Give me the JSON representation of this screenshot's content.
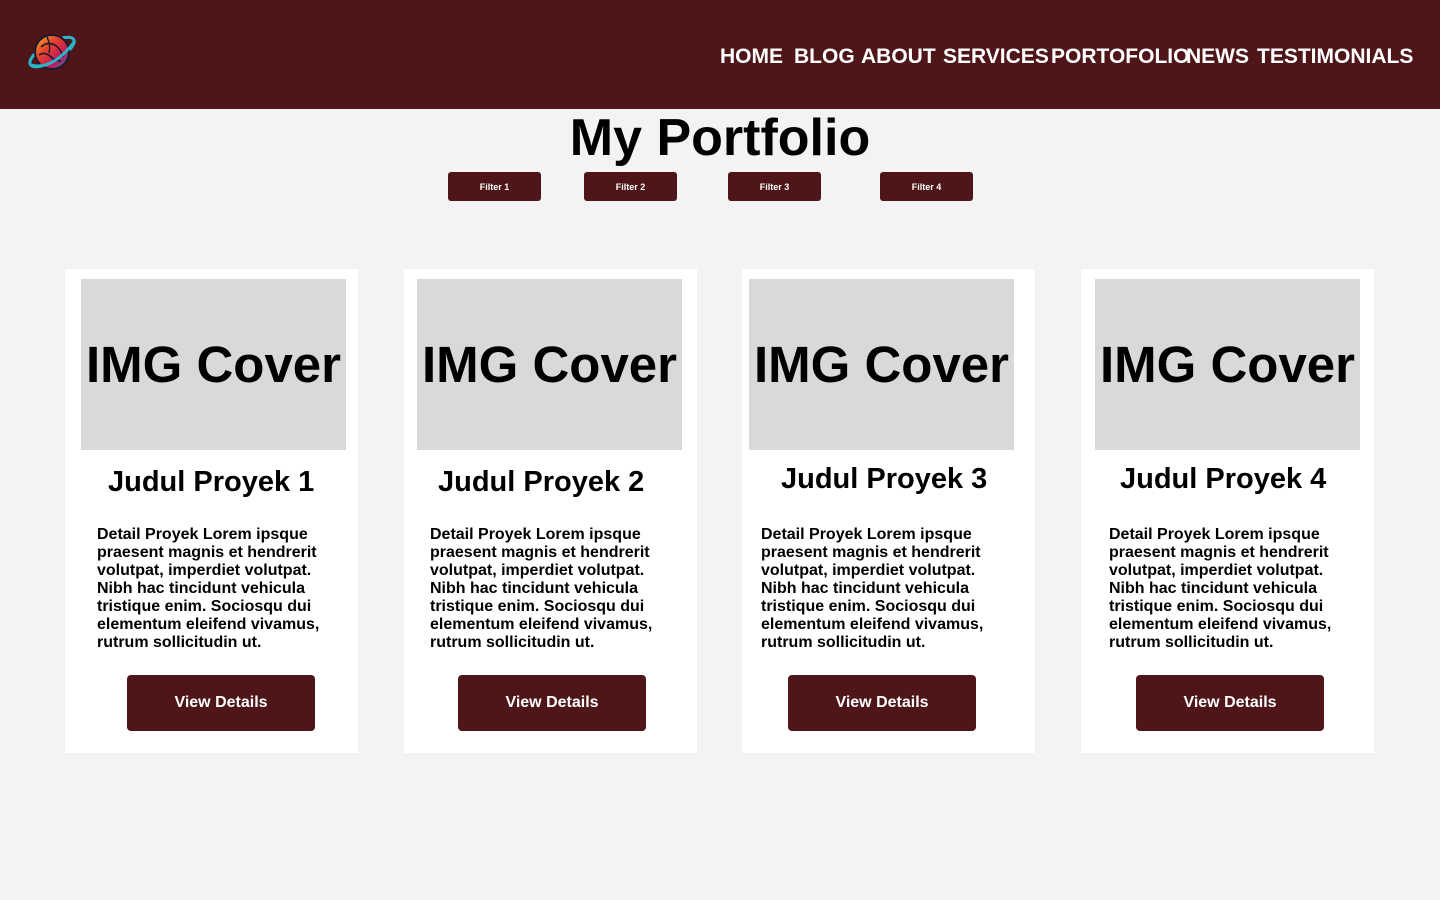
{
  "header": {
    "logo_icon": "globe-logo-icon",
    "background": "#4e1618",
    "nav": [
      "HOME",
      "BLOG",
      "ABOUT",
      "SERVICES",
      "PORTOFOLIO",
      "NEWS",
      "TESTIMONIALS"
    ]
  },
  "main": {
    "title": "My Portfolio",
    "filters": [
      "Filter 1",
      "Filter 2",
      "Filter 3",
      "Filter 4"
    ],
    "projects": [
      {
        "image_label": "IMG Cover",
        "title": "Judul Proyek 1",
        "description": "Detail Proyek Lorem ipsque praesent magnis et hendrerit volutpat, imperdiet volutpat. Nibh hac tincidunt vehicula tristique enim. Sociosqu dui elementum eleifend vivamus, rutrum sollicitudin ut.",
        "button": "View Details"
      },
      {
        "image_label": "IMG Cover",
        "title": "Judul Proyek 2",
        "description": "Detail Proyek Lorem ipsque praesent magnis et hendrerit volutpat, imperdiet volutpat. Nibh hac tincidunt vehicula tristique enim. Sociosqu dui elementum eleifend vivamus, rutrum sollicitudin ut.",
        "button": "View Details"
      },
      {
        "image_label": "IMG Cover",
        "title": "Judul Proyek 3",
        "description": "Detail Proyek Lorem ipsque praesent magnis et hendrerit volutpat, imperdiet volutpat. Nibh hac tincidunt vehicula tristique enim. Sociosqu dui elementum eleifend vivamus, rutrum sollicitudin ut.",
        "button": "View Details"
      },
      {
        "image_label": "IMG Cover",
        "title": "Judul Proyek 4",
        "description": "Detail Proyek Lorem ipsque praesent magnis et hendrerit volutpat, imperdiet volutpat. Nibh hac tincidunt vehicula tristique enim. Sociosqu dui elementum eleifend vivamus, rutrum sollicitudin ut.",
        "button": "View Details"
      }
    ]
  },
  "colors": {
    "primary": "#4e1618",
    "page_background": "#f3f3f3",
    "card_background": "#ffffff",
    "image_placeholder": "#d9d9d9"
  }
}
